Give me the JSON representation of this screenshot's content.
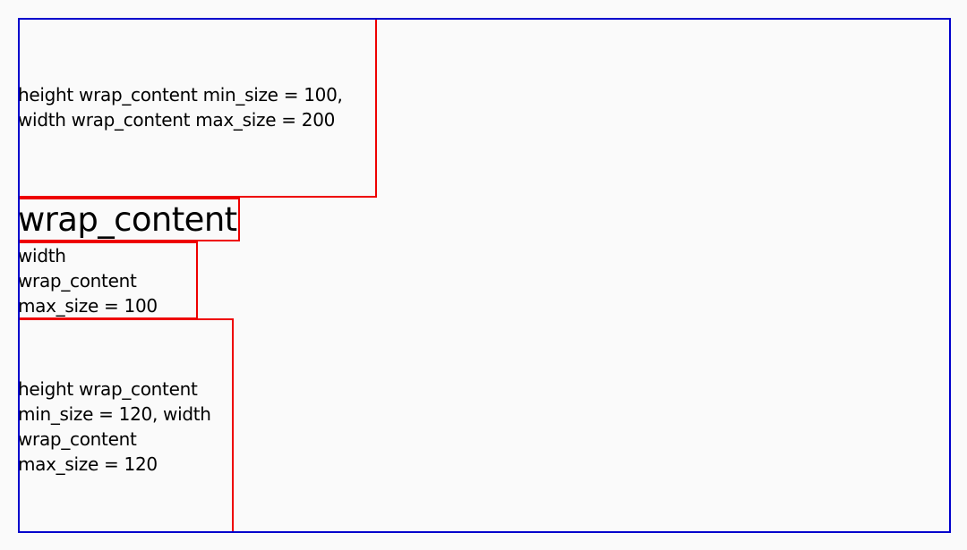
{
  "boxes": {
    "box1": {
      "label": "height wrap_content min_size = 100,\nwidth wrap_content max_size = 200"
    },
    "box2": {
      "label": "wrap_content"
    },
    "box3": {
      "label": "width\nwrap_content\nmax_size = 100"
    },
    "box4": {
      "label": "height wrap_content\nmin_size = 120, width\nwrap_content\nmax_size = 120"
    }
  },
  "colors": {
    "container_border": "#0000cc",
    "box_border": "#ee0000",
    "background": "#fafafa"
  }
}
